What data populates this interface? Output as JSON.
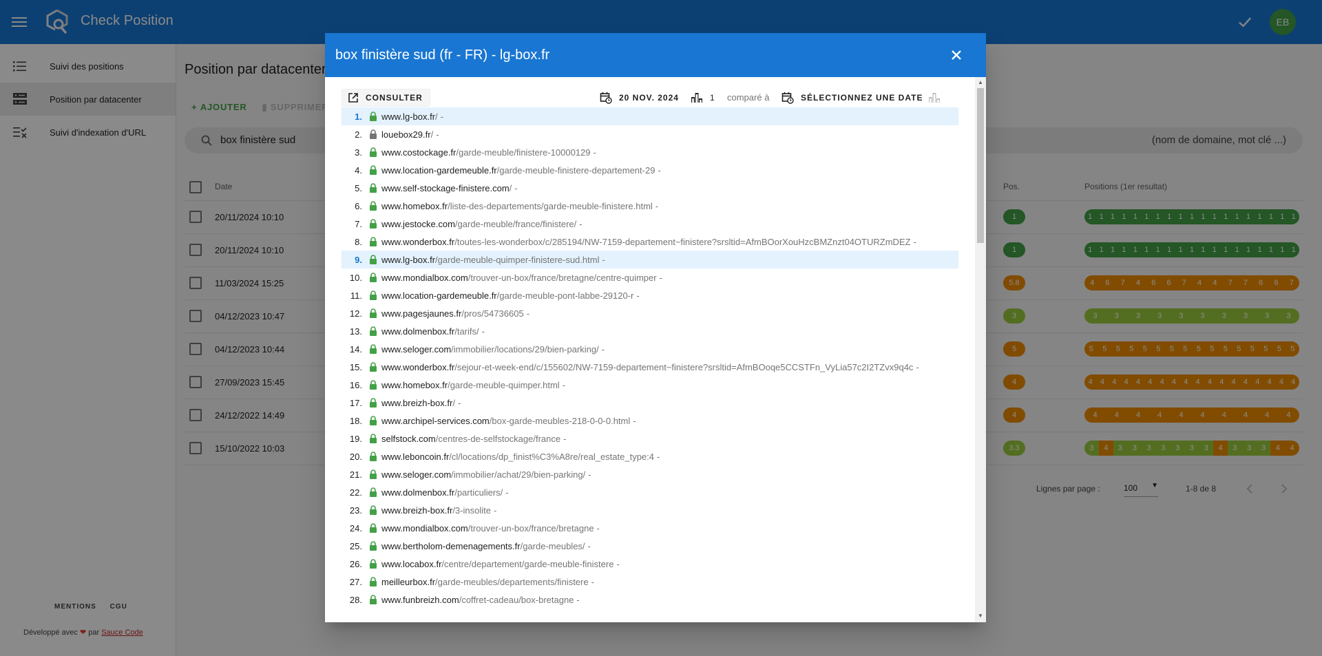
{
  "app": {
    "title": "Check Position",
    "avatar_initials": "EB",
    "accent": "#1976d2"
  },
  "sidebar": {
    "items": [
      {
        "label": "Suivi des positions",
        "icon": "list-icon",
        "active": false
      },
      {
        "label": "Position par datacenter",
        "icon": "server-icon",
        "active": true
      },
      {
        "label": "Suivi d'indexation d'URL",
        "icon": "checklist-icon",
        "active": false
      }
    ],
    "footer_links": [
      "MENTIONS",
      "CGU"
    ],
    "credit_prefix": "Développé avec",
    "credit_mid": "par",
    "credit_link": "Sauce Code"
  },
  "main": {
    "page_title": "Position par datacenter",
    "add_label": "AJOUTER",
    "delete_label": "SUPPRIMER",
    "search_value": "box finistère sud",
    "search_hint": "(nom de domaine, mot clé ...)",
    "columns": {
      "date": "Date",
      "pos": "Pos.",
      "positions": "Positions (1er resultat)"
    },
    "rows": [
      {
        "date": "20/11/2024 10:10",
        "pos": "1",
        "color": "#43a047",
        "positions": [
          "1",
          "1",
          "1",
          "1",
          "1",
          "1",
          "1",
          "1",
          "1",
          "1",
          "1",
          "1",
          "1",
          "1",
          "1",
          "1",
          "1",
          "1",
          "1"
        ],
        "colors": [
          "#43a047"
        ]
      },
      {
        "date": "20/11/2024 10:10",
        "pos": "1",
        "color": "#43a047",
        "positions": [
          "1",
          "1",
          "1",
          "1",
          "1",
          "1",
          "1",
          "1",
          "1",
          "1",
          "1",
          "1",
          "1",
          "1",
          "1",
          "1",
          "1",
          "1",
          "1"
        ],
        "colors": [
          "#43a047"
        ]
      },
      {
        "date": "11/03/2024 15:25",
        "pos": "5.8",
        "color": "#ef8c00",
        "positions": [
          "4",
          "6",
          "7",
          "4",
          "6",
          "6",
          "7",
          "4",
          "4",
          "7",
          "7",
          "6",
          "6",
          "7"
        ],
        "colors": [
          "#ef8c00"
        ]
      },
      {
        "date": "04/12/2023 10:47",
        "pos": "3",
        "color": "#9ccc3d",
        "positions": [
          "3",
          "3",
          "3",
          "3",
          "3",
          "3",
          "3",
          "3",
          "3",
          "3"
        ],
        "colors": [
          "#9ccc3d"
        ]
      },
      {
        "date": "04/12/2023 10:44",
        "pos": "5",
        "color": "#ef8c00",
        "positions": [
          "5",
          "5",
          "5",
          "5",
          "5",
          "5",
          "5",
          "5",
          "5",
          "5",
          "5",
          "5",
          "5",
          "5",
          "5",
          "5"
        ],
        "colors": [
          "#ef8c00"
        ]
      },
      {
        "date": "27/09/2023 15:45",
        "pos": "4",
        "color": "#ef8c00",
        "positions": [
          "4",
          "4",
          "4",
          "4",
          "4",
          "4",
          "4",
          "4",
          "4",
          "4",
          "4",
          "4",
          "4",
          "4",
          "4",
          "4",
          "4",
          "4"
        ],
        "colors": [
          "#ef8c00"
        ]
      },
      {
        "date": "24/12/2022 14:49",
        "pos": "4",
        "color": "#ef8c00",
        "positions": [
          "4",
          "4",
          "4",
          "4",
          "4",
          "4",
          "4",
          "4",
          "4",
          "4"
        ],
        "colors": [
          "#ef8c00"
        ]
      },
      {
        "date": "15/10/2022 10:03",
        "pos": "3.3",
        "color": "#9ccc3d",
        "positions": [
          "3",
          "4",
          "3",
          "3",
          "3",
          "3",
          "3",
          "3",
          "3",
          "4",
          "3",
          "3",
          "3",
          "4",
          "4"
        ],
        "colors": [
          "#9ccc3d",
          "#ef8c00"
        ]
      }
    ],
    "rows_per_page_label": "Lignes par page :",
    "rows_per_page": "100",
    "range": "1-8 de 8"
  },
  "dialog": {
    "title": "box finistère sud (fr - FR) - lg-box.fr",
    "consult_label": "CONSULTER",
    "date": "20 NOV. 2024",
    "datacenter_count": "1",
    "compare_label": "comparé à",
    "select_date_label": "SÉLECTIONNEZ UNE DATE",
    "results": [
      {
        "n": "1.",
        "domain": "www.lg-box.fr",
        "path": "/",
        "hl": true
      },
      {
        "n": "2.",
        "domain": "louebox29.fr",
        "path": "/",
        "hl": false,
        "grey": true
      },
      {
        "n": "3.",
        "domain": "www.costockage.fr",
        "path": "/garde-meuble/finistere-10000129",
        "hl": false
      },
      {
        "n": "4.",
        "domain": "www.location-gardemeuble.fr",
        "path": "/garde-meuble-finistere-departement-29",
        "hl": false
      },
      {
        "n": "5.",
        "domain": "www.self-stockage-finistere.com",
        "path": "/",
        "hl": false
      },
      {
        "n": "6.",
        "domain": "www.homebox.fr",
        "path": "/liste-des-departements/garde-meuble-finistere.html",
        "hl": false
      },
      {
        "n": "7.",
        "domain": "www.jestocke.com",
        "path": "/garde-meuble/france/finistere/",
        "hl": false
      },
      {
        "n": "8.",
        "domain": "www.wonderbox.fr",
        "path": "/toutes-les-wonderbox/c/285194/NW-7159-departement~finistere?srsltid=AfmBOorXouHzcBMZnzt04OTURZmDEZ",
        "hl": false
      },
      {
        "n": "9.",
        "domain": "www.lg-box.fr",
        "path": "/garde-meuble-quimper-finistere-sud.html",
        "hl": true
      },
      {
        "n": "10.",
        "domain": "www.mondialbox.com",
        "path": "/trouver-un-box/france/bretagne/centre-quimper",
        "hl": false
      },
      {
        "n": "11.",
        "domain": "www.location-gardemeuble.fr",
        "path": "/garde-meuble-pont-labbe-29120-r",
        "hl": false
      },
      {
        "n": "12.",
        "domain": "www.pagesjaunes.fr",
        "path": "/pros/54736605",
        "hl": false
      },
      {
        "n": "13.",
        "domain": "www.dolmenbox.fr",
        "path": "/tarifs/",
        "hl": false
      },
      {
        "n": "14.",
        "domain": "www.seloger.com",
        "path": "/immobilier/locations/29/bien-parking/",
        "hl": false
      },
      {
        "n": "15.",
        "domain": "www.wonderbox.fr",
        "path": "/sejour-et-week-end/c/155602/NW-7159-departement~finistere?srsltid=AfmBOoqe5CCSTFn_VyLia57c2I2TZvx9q4c",
        "hl": false
      },
      {
        "n": "16.",
        "domain": "www.homebox.fr",
        "path": "/garde-meuble-quimper.html",
        "hl": false
      },
      {
        "n": "17.",
        "domain": "www.breizh-box.fr",
        "path": "/",
        "hl": false
      },
      {
        "n": "18.",
        "domain": "www.archipel-services.com",
        "path": "/box-garde-meubles-218-0-0-0.html",
        "hl": false
      },
      {
        "n": "19.",
        "domain": "selfstock.com",
        "path": "/centres-de-selfstockage/france",
        "hl": false
      },
      {
        "n": "20.",
        "domain": "www.leboncoin.fr",
        "path": "/cl/locations/dp_finist%C3%A8re/real_estate_type:4",
        "hl": false
      },
      {
        "n": "21.",
        "domain": "www.seloger.com",
        "path": "/immobilier/achat/29/bien-parking/",
        "hl": false
      },
      {
        "n": "22.",
        "domain": "www.dolmenbox.fr",
        "path": "/particuliers/",
        "hl": false
      },
      {
        "n": "23.",
        "domain": "www.breizh-box.fr",
        "path": "/3-insolite",
        "hl": false
      },
      {
        "n": "24.",
        "domain": "www.mondialbox.com",
        "path": "/trouver-un-box/france/bretagne",
        "hl": false
      },
      {
        "n": "25.",
        "domain": "www.bertholom-demenagements.fr",
        "path": "/garde-meubles/",
        "hl": false
      },
      {
        "n": "26.",
        "domain": "www.locabox.fr",
        "path": "/centre/departement/garde-meuble-finistere",
        "hl": false
      },
      {
        "n": "27.",
        "domain": "meilleurbox.fr",
        "path": "/garde-meubles/departements/finistere",
        "hl": false
      },
      {
        "n": "28.",
        "domain": "www.funbreizh.com",
        "path": "/coffret-cadeau/box-bretagne",
        "hl": false
      }
    ],
    "separator": "-"
  }
}
